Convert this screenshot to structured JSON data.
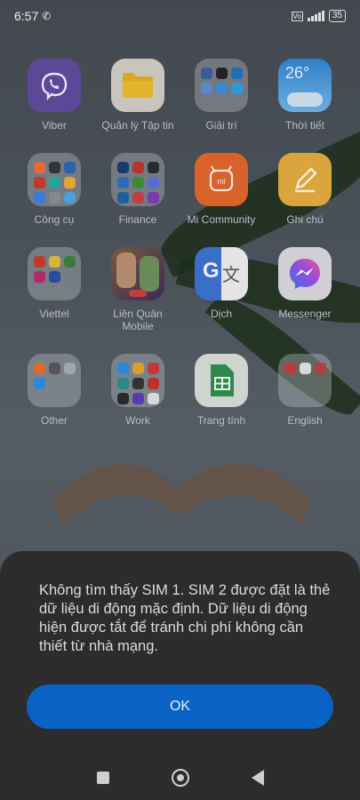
{
  "status_bar": {
    "time": "6:57",
    "battery": "35"
  },
  "apps": [
    {
      "label": "Viber",
      "icon": "viber-icon"
    },
    {
      "label": "Quản lý Tập tin",
      "icon": "folder-icon"
    },
    {
      "label": "Giải trí",
      "icon": "folder-group-icon"
    },
    {
      "label": "Thời tiết",
      "icon": "weather-icon",
      "icon_text": "26°"
    },
    {
      "label": "Công cụ",
      "icon": "folder-group-icon"
    },
    {
      "label": "Finance",
      "icon": "folder-group-icon"
    },
    {
      "label": "Mi Community",
      "icon": "mi-community-icon"
    },
    {
      "label": "Ghi chú",
      "icon": "notes-icon"
    },
    {
      "label": "Viettel",
      "icon": "folder-group-icon"
    },
    {
      "label": "Liên Quân Mobile",
      "icon": "game-icon"
    },
    {
      "label": "Dịch",
      "icon": "translate-icon"
    },
    {
      "label": "Messenger",
      "icon": "messenger-icon"
    },
    {
      "label": "Other",
      "icon": "folder-group-icon"
    },
    {
      "label": "Work",
      "icon": "folder-group-icon"
    },
    {
      "label": "Trang tính",
      "icon": "sheets-icon"
    },
    {
      "label": "English",
      "icon": "folder-group-icon"
    }
  ],
  "dialog": {
    "message": "Không tìm thấy SIM 1. SIM 2 được đặt là thẻ dữ liệu di động mặc định. Dữ liệu di động hiện được tắt để tránh chi phí không cần thiết từ nhà mạng.",
    "ok_label": "OK"
  },
  "colors": {
    "dialog_bg": "#2c2c2c",
    "ok_button": "#0a63c4"
  }
}
